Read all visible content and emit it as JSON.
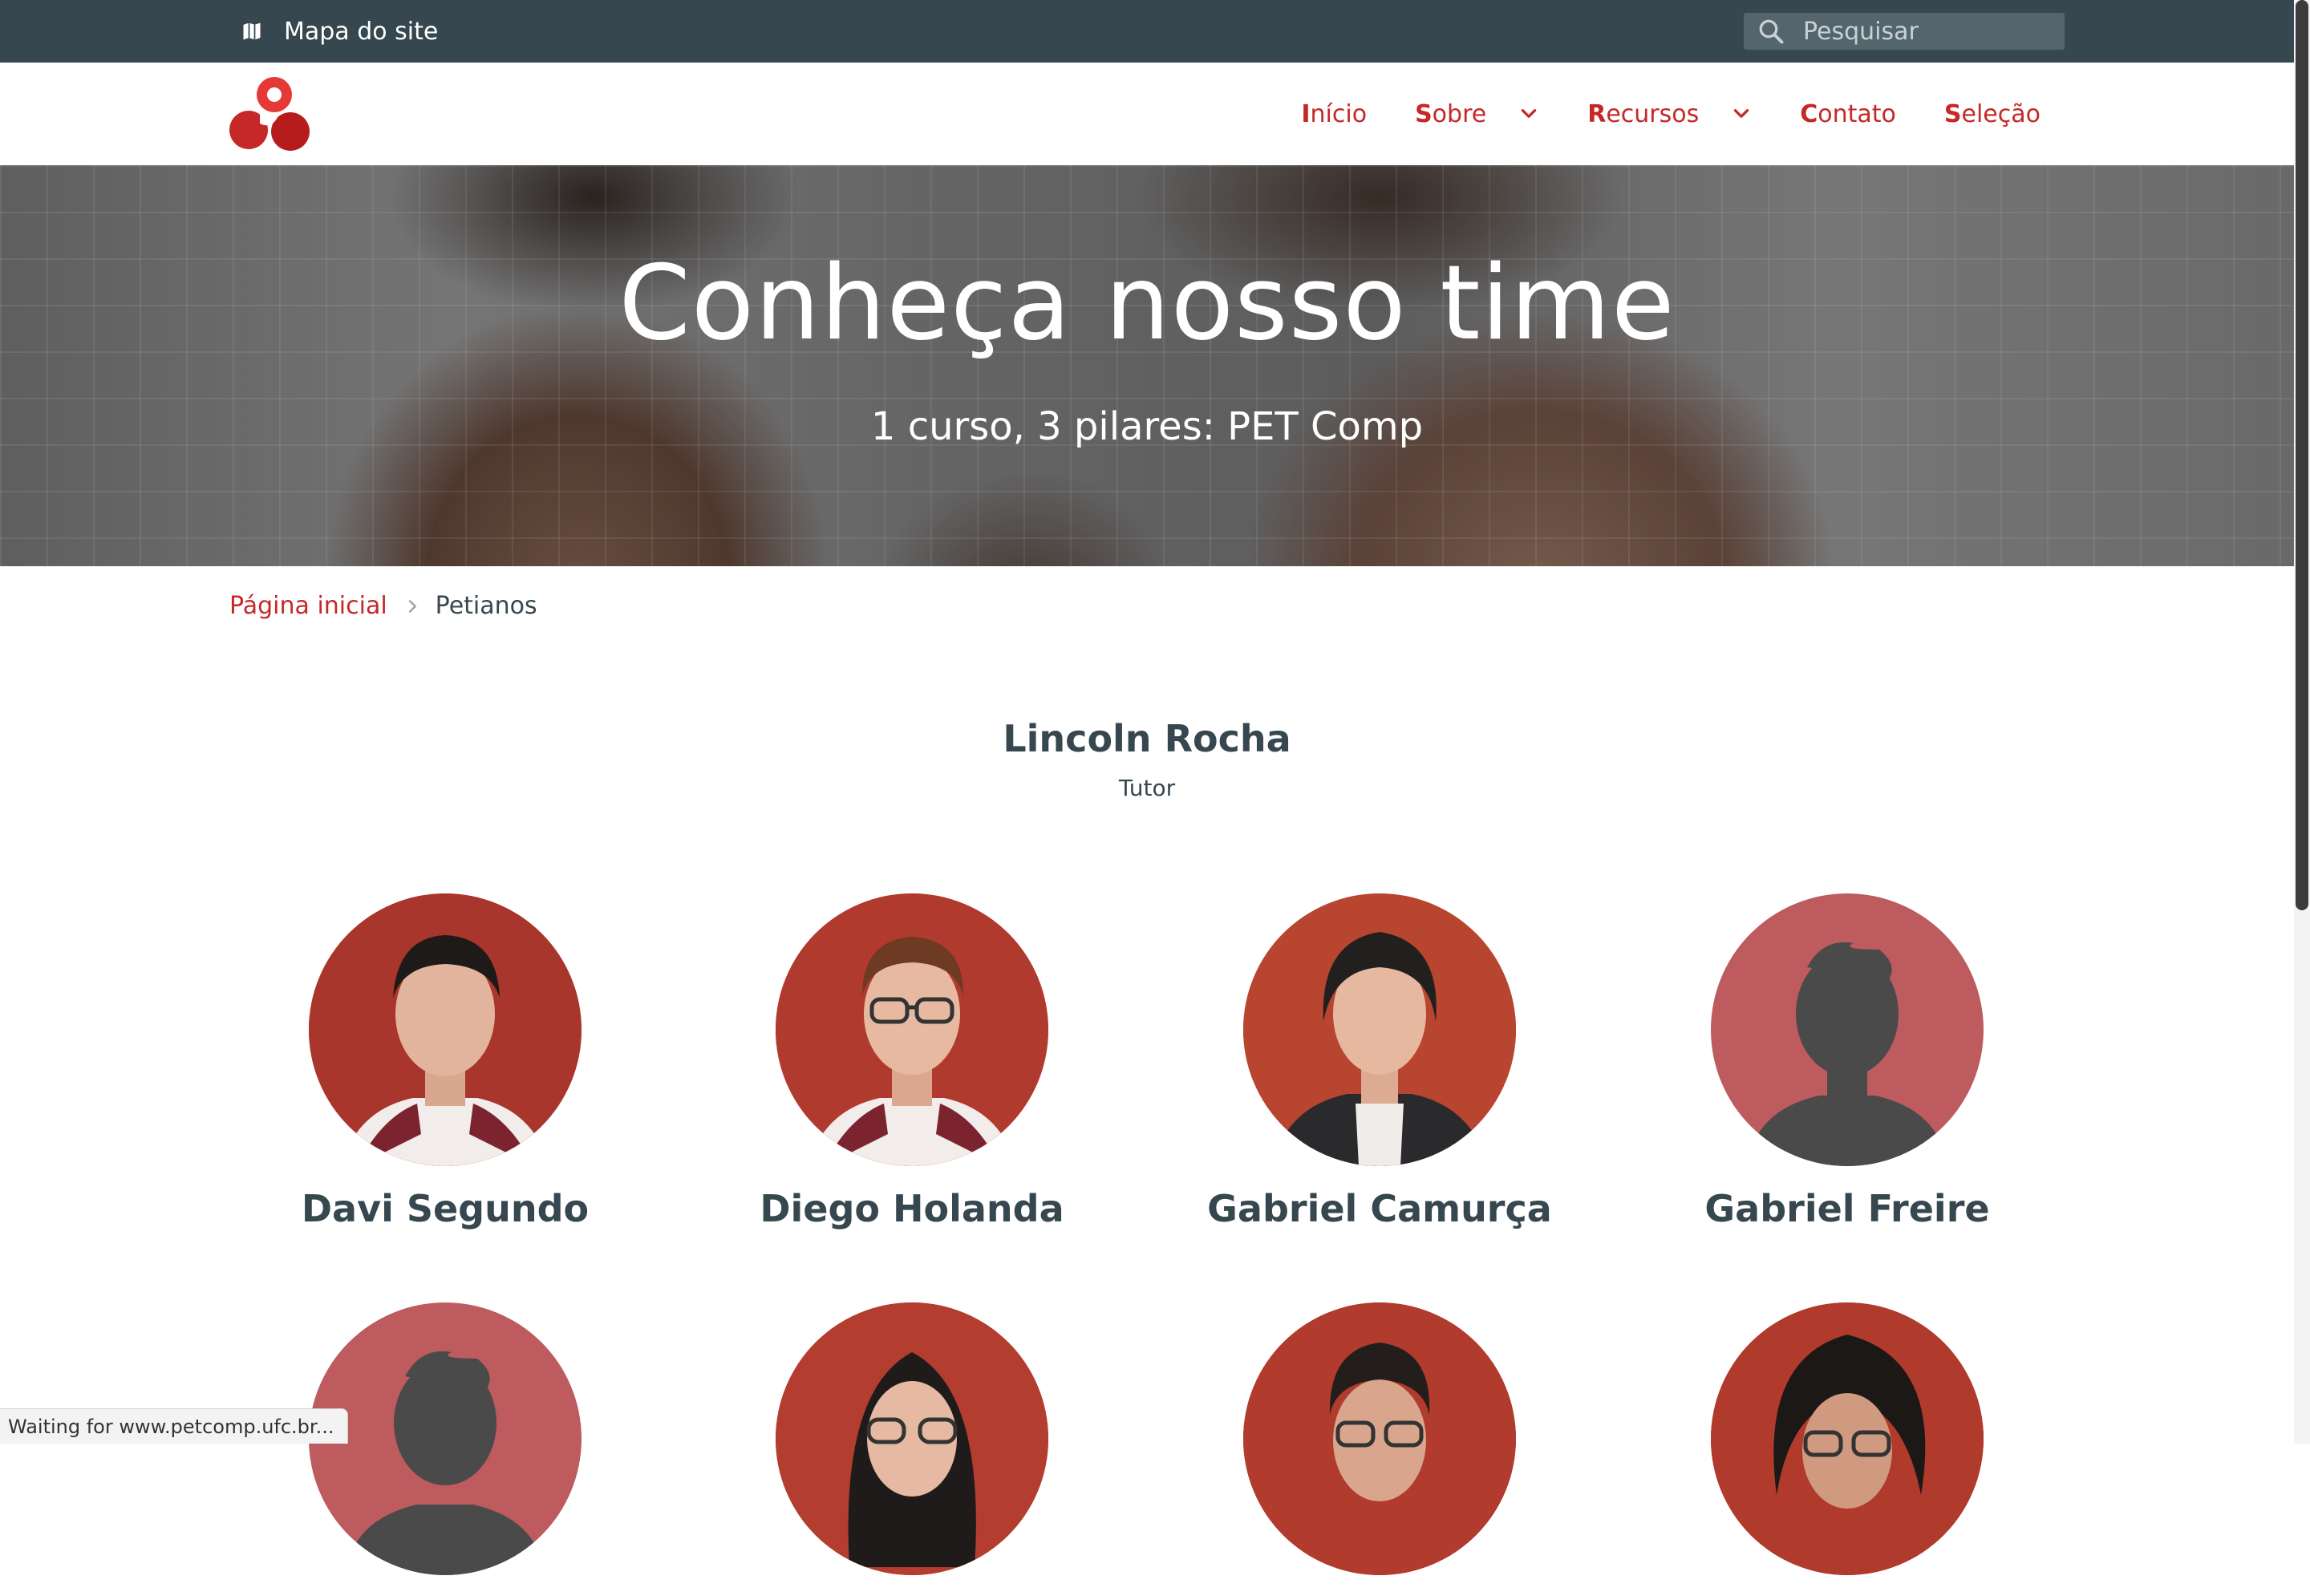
{
  "topbar": {
    "sitemap_label": "Mapa do site",
    "search_placeholder": "Pesquisar",
    "background": "#37474f"
  },
  "header": {
    "logo_icon": "petcomp-logo-icon",
    "nav": [
      {
        "initial": "I",
        "rest": "nício",
        "has_dropdown": false
      },
      {
        "initial": "S",
        "rest": "obre",
        "has_dropdown": true
      },
      {
        "initial": "R",
        "rest": "ecursos",
        "has_dropdown": true
      },
      {
        "initial": "C",
        "rest": "ontato",
        "has_dropdown": false
      },
      {
        "initial": "S",
        "rest": "eleção",
        "has_dropdown": false
      }
    ],
    "accent": "#c62828"
  },
  "hero": {
    "title": "Conheça nosso time",
    "subtitle": "1 curso, 3 pilares: PET Comp"
  },
  "breadcrumb": {
    "home": "Página inicial",
    "current": "Petianos"
  },
  "tutor": {
    "name": "Lincoln Rocha",
    "role": "Tutor"
  },
  "members": [
    {
      "name": "Davi Segundo",
      "photo": "photo"
    },
    {
      "name": "Diego Holanda",
      "photo": "photo"
    },
    {
      "name": "Gabriel Camurça",
      "photo": "photo"
    },
    {
      "name": "Gabriel Freire",
      "photo": "placeholder"
    },
    {
      "name": "",
      "photo": "placeholder"
    },
    {
      "name": "",
      "photo": "photo"
    },
    {
      "name": "",
      "photo": "photo"
    },
    {
      "name": "",
      "photo": "photo"
    }
  ],
  "status_bar": "Waiting for www.petcomp.ufc.br..."
}
